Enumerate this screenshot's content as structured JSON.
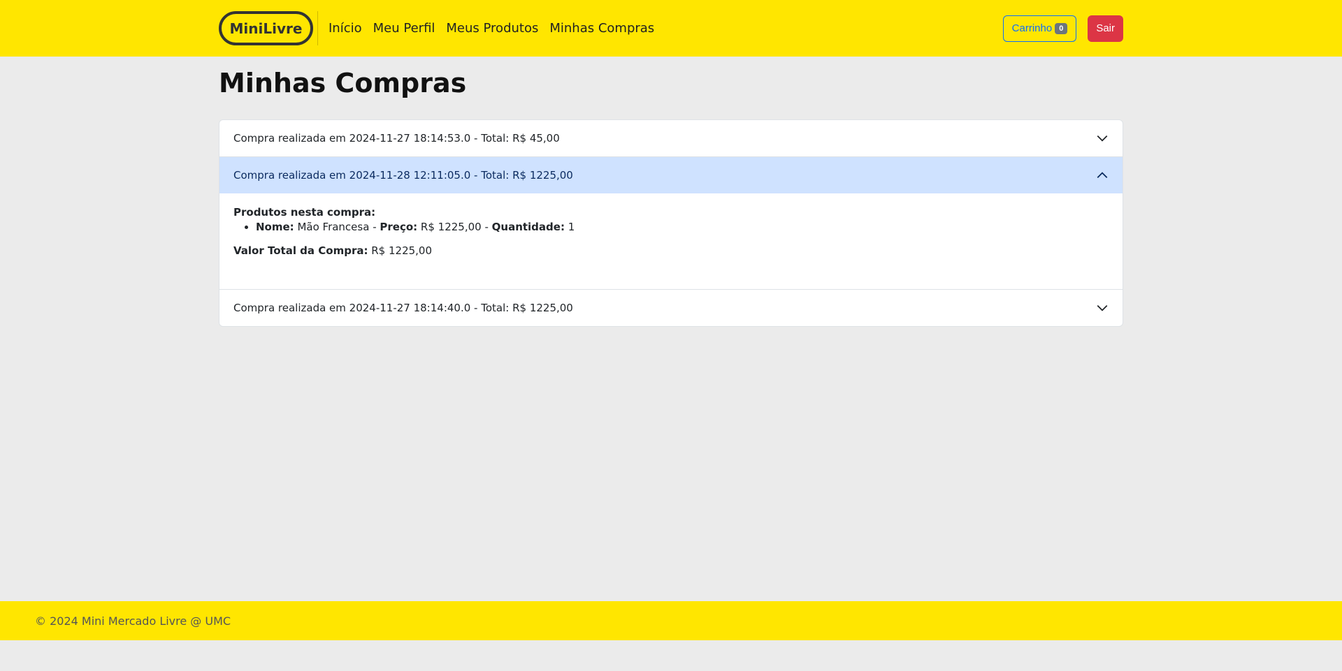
{
  "nav": {
    "brand": "MiniLivre",
    "links": [
      "Início",
      "Meu Perfil",
      "Meus Produtos",
      "Minhas Compras"
    ],
    "cart_label": "Carrinho",
    "cart_count": "0",
    "logout_label": "Sair"
  },
  "page": {
    "title": "Minhas Compras"
  },
  "purchases": [
    {
      "header": "Compra realizada em 2024-11-27 18:14:53.0 - Total: R$ 45,00",
      "expanded": false
    },
    {
      "header": "Compra realizada em 2024-11-28 12:11:05.0 - Total: R$ 1225,00",
      "expanded": true,
      "details": {
        "products_heading": "Produtos nesta compra:",
        "product": {
          "name_label": "Nome:",
          "name": "Mão Francesa",
          "sep1": " - ",
          "price_label": "Preço:",
          "price": "R$ 1225,00",
          "sep2": " - ",
          "qty_label": "Quantidade:",
          "qty": "1"
        },
        "total_label": "Valor Total da Compra:",
        "total": "R$ 1225,00"
      }
    },
    {
      "header": "Compra realizada em 2024-11-27 18:14:40.0 - Total: R$ 1225,00",
      "expanded": false
    }
  ],
  "footer": {
    "text": "© 2024 Mini Mercado Livre @ UMC"
  },
  "colors": {
    "brand_yellow": "#ffe600",
    "accordion_open_bg": "#cfe2ff",
    "danger": "#dc3545",
    "primary": "#0d6efd"
  },
  "icons": {
    "collapsed": "chevron-down-icon",
    "expanded": "chevron-up-icon"
  }
}
